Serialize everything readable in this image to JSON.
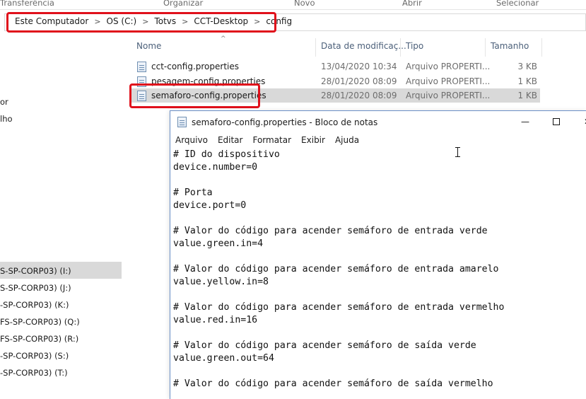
{
  "ribbon": {
    "groups": [
      "Transferência",
      "Organizar",
      "Novo",
      "Abrir",
      "Selecionar"
    ]
  },
  "breadcrumb": [
    "Este Computador",
    "OS (C:)",
    "Totvs",
    "CCT-Desktop",
    "config"
  ],
  "nav": {
    "items": [
      "or",
      "lho",
      "S-SP-CORP03) (I:)",
      "S-SP-CORP03) (J:)",
      "-SP-CORP03) (K:)",
      "FS-SP-CORP03) (Q:)",
      "FS-SP-CORP03) (R:)",
      "-SP-CORP03) (S:)",
      "-SP-CORP03) (T:)"
    ]
  },
  "columns": {
    "name": "Nome",
    "date": "Data de modificaç...",
    "type": "Tipo",
    "size": "Tamanho"
  },
  "files": [
    {
      "name": "cct-config.properties",
      "date": "13/04/2020 10:34",
      "type": "Arquivo PROPERTI...",
      "size": "3 KB",
      "selected": false
    },
    {
      "name": "pesagem-config.properties",
      "date": "28/01/2020 08:09",
      "type": "Arquivo PROPERTI...",
      "size": "1 KB",
      "selected": false
    },
    {
      "name": "semaforo-config.properties",
      "date": "28/01/2020 08:09",
      "type": "Arquivo PROPERTI...",
      "size": "1 KB",
      "selected": true
    }
  ],
  "notepad": {
    "title": "semaforo-config.properties - Bloco de notas",
    "menu": [
      "Arquivo",
      "Editar",
      "Formatar",
      "Exibir",
      "Ajuda"
    ],
    "content": "# ID do dispositivo\ndevice.number=0\n\n# Porta\ndevice.port=0\n\n# Valor do código para acender semáforo de entrada verde\nvalue.green.in=4\n\n# Valor do código para acender semáforo de entrada amarelo\nvalue.yellow.in=8\n\n# Valor do código para acender semáforo de entrada vermelho\nvalue.red.in=16\n\n# Valor do código para acender semáforo de saída verde\nvalue.green.out=64\n\n# Valor do código para acender semáforo de saída vermelho"
  },
  "colors": {
    "highlight": "#e0101b",
    "selection": "#d9d9d9",
    "header_text": "#4c607a"
  }
}
